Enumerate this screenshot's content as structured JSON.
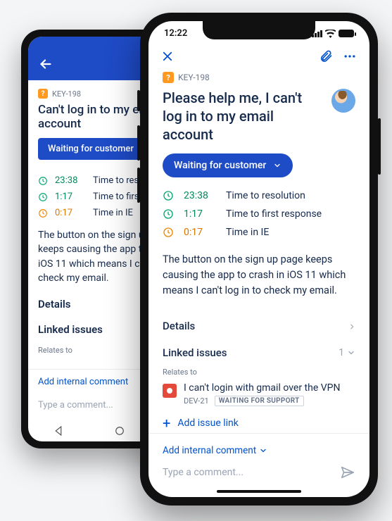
{
  "colors": {
    "primary": "#1e4bc6",
    "link": "#0052cc",
    "ok": "#00a86b",
    "warn": "#f08400"
  },
  "statusbar": {
    "time": "12:22"
  },
  "issue": {
    "key": "KEY-198",
    "title_full": "Please help me, I can't log in to my email account",
    "title_short": "Can't log in to my email account",
    "status": "Waiting for customer",
    "description": "The button on the sign up page keeps causing the app to crash in iOS 11 which means I can't log in to check my email."
  },
  "sla": [
    {
      "time": "23:38",
      "label": "Time to resolution",
      "label_short": "Time to resolution",
      "state": "ok"
    },
    {
      "time": "1:17",
      "label": "Time to first response",
      "label_short": "Time to first response",
      "state": "ok"
    },
    {
      "time": "0:17",
      "label": "Time in IE",
      "label_short": "Time in IE",
      "state": "warn"
    }
  ],
  "sections": {
    "details": "Details",
    "linked": "Linked issues",
    "linked_count": "1",
    "relates_to": "Relates to"
  },
  "linked_issue": {
    "summary": "I can't login with gmail over the VPN",
    "key": "DEV-21",
    "status": "WAITING FOR SUPPORT"
  },
  "actions": {
    "add_issue_link": "Add issue link",
    "add_internal_comment": "Add internal comment",
    "compose_placeholder": "Type a comment..."
  }
}
